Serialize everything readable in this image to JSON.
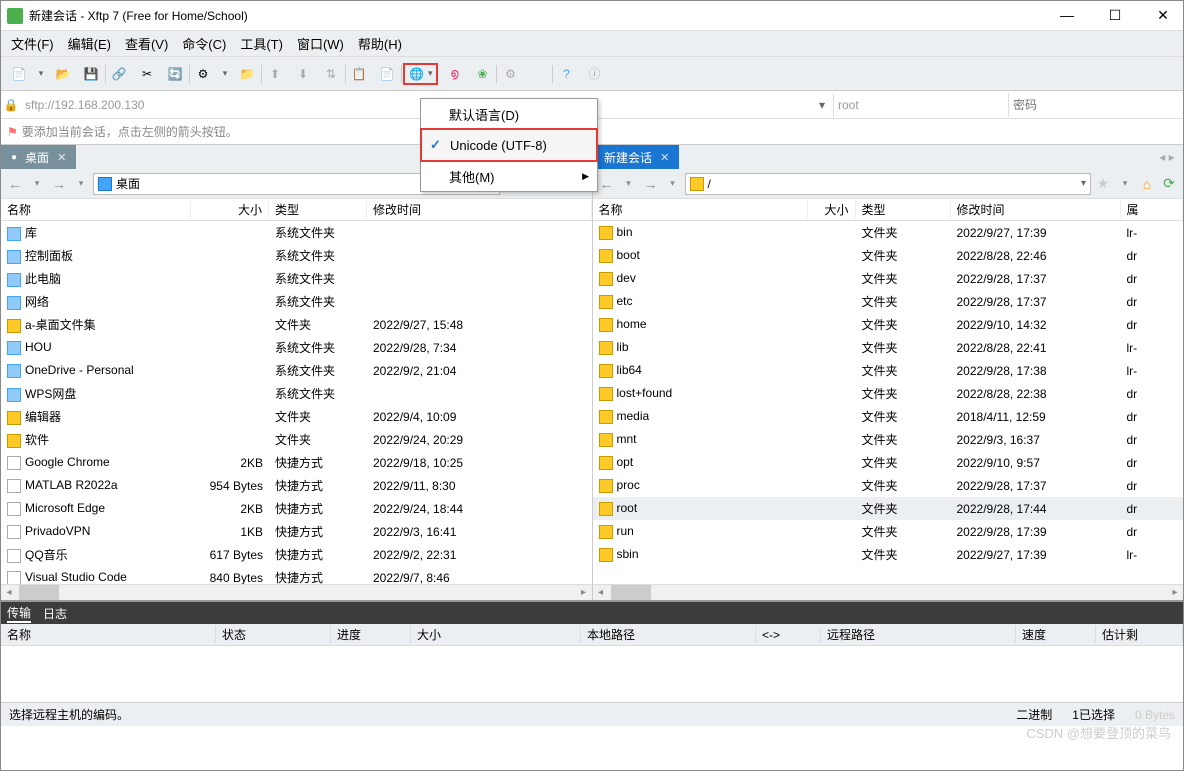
{
  "title": "新建会话 - Xftp 7 (Free for Home/School)",
  "menu": {
    "file": "文件(F)",
    "edit": "编辑(E)",
    "view": "查看(V)",
    "cmd": "命令(C)",
    "tool": "工具(T)",
    "win": "窗口(W)",
    "help": "帮助(H)"
  },
  "addr": {
    "url": "sftp://192.168.200.130",
    "user": "root",
    "pass_ph": "密码"
  },
  "hint": "要添加当前会话，点击左侧的箭头按钮。",
  "langmenu": {
    "default": "默认语言(D)",
    "utf8": "Unicode (UTF-8)",
    "other": "其他(M)"
  },
  "tabs": {
    "local": "桌面",
    "remote": "新建会话"
  },
  "local_path": "桌面",
  "remote_path": "/",
  "cols": {
    "name": "名称",
    "size": "大小",
    "type": "类型",
    "mtime": "修改时间",
    "attr": "属"
  },
  "remote_size_hdr": "大小",
  "local_files": [
    {
      "n": "库",
      "s": "",
      "t": "系统文件夹",
      "m": "",
      "i": "sys"
    },
    {
      "n": "控制面板",
      "s": "",
      "t": "系统文件夹",
      "m": "",
      "i": "sys"
    },
    {
      "n": "此电脑",
      "s": "",
      "t": "系统文件夹",
      "m": "",
      "i": "sys"
    },
    {
      "n": "网络",
      "s": "",
      "t": "系统文件夹",
      "m": "",
      "i": "sys"
    },
    {
      "n": "a-桌面文件集",
      "s": "",
      "t": "文件夹",
      "m": "2022/9/27, 15:48",
      "i": "f"
    },
    {
      "n": "HOU",
      "s": "",
      "t": "系统文件夹",
      "m": "2022/9/28, 7:34",
      "i": "sys"
    },
    {
      "n": "OneDrive - Personal",
      "s": "",
      "t": "系统文件夹",
      "m": "2022/9/2, 21:04",
      "i": "sys"
    },
    {
      "n": "WPS网盘",
      "s": "",
      "t": "系统文件夹",
      "m": "",
      "i": "sys"
    },
    {
      "n": "编辑器",
      "s": "",
      "t": "文件夹",
      "m": "2022/9/4, 10:09",
      "i": "f"
    },
    {
      "n": "软件",
      "s": "",
      "t": "文件夹",
      "m": "2022/9/24, 20:29",
      "i": "f"
    },
    {
      "n": "Google Chrome",
      "s": "2KB",
      "t": "快捷方式",
      "m": "2022/9/18, 10:25",
      "i": "link"
    },
    {
      "n": "MATLAB R2022a",
      "s": "954 Bytes",
      "t": "快捷方式",
      "m": "2022/9/11, 8:30",
      "i": "link"
    },
    {
      "n": "Microsoft Edge",
      "s": "2KB",
      "t": "快捷方式",
      "m": "2022/9/24, 18:44",
      "i": "link"
    },
    {
      "n": "PrivadoVPN",
      "s": "1KB",
      "t": "快捷方式",
      "m": "2022/9/3, 16:41",
      "i": "link"
    },
    {
      "n": "QQ音乐",
      "s": "617 Bytes",
      "t": "快捷方式",
      "m": "2022/9/2, 22:31",
      "i": "link"
    },
    {
      "n": "Visual Studio Code",
      "s": "840 Bytes",
      "t": "快捷方式",
      "m": "2022/9/7, 8:46",
      "i": "link"
    }
  ],
  "remote_files": [
    {
      "n": "bin",
      "t": "文件夹",
      "m": "2022/9/27, 17:39",
      "a": "lr-"
    },
    {
      "n": "boot",
      "t": "文件夹",
      "m": "2022/8/28, 22:46",
      "a": "dr"
    },
    {
      "n": "dev",
      "t": "文件夹",
      "m": "2022/9/28, 17:37",
      "a": "dr"
    },
    {
      "n": "etc",
      "t": "文件夹",
      "m": "2022/9/28, 17:37",
      "a": "dr"
    },
    {
      "n": "home",
      "t": "文件夹",
      "m": "2022/9/10, 14:32",
      "a": "dr"
    },
    {
      "n": "lib",
      "t": "文件夹",
      "m": "2022/8/28, 22:41",
      "a": "lr-"
    },
    {
      "n": "lib64",
      "t": "文件夹",
      "m": "2022/9/28, 17:38",
      "a": "lr-"
    },
    {
      "n": "lost+found",
      "t": "文件夹",
      "m": "2022/8/28, 22:38",
      "a": "dr"
    },
    {
      "n": "media",
      "t": "文件夹",
      "m": "2018/4/11, 12:59",
      "a": "dr"
    },
    {
      "n": "mnt",
      "t": "文件夹",
      "m": "2022/9/3, 16:37",
      "a": "dr"
    },
    {
      "n": "opt",
      "t": "文件夹",
      "m": "2022/9/10, 9:57",
      "a": "dr"
    },
    {
      "n": "proc",
      "t": "文件夹",
      "m": "2022/9/28, 17:37",
      "a": "dr"
    },
    {
      "n": "root",
      "t": "文件夹",
      "m": "2022/9/28, 17:44",
      "a": "dr",
      "sel": true
    },
    {
      "n": "run",
      "t": "文件夹",
      "m": "2022/9/28, 17:39",
      "a": "dr"
    },
    {
      "n": "sbin",
      "t": "文件夹",
      "m": "2022/9/27, 17:39",
      "a": "lr-"
    }
  ],
  "logtabs": {
    "transfer": "传输",
    "log": "日志"
  },
  "logcols": {
    "name": "名称",
    "status": "状态",
    "progress": "进度",
    "size": "大小",
    "localpath": "本地路径",
    "arrow": "<->",
    "remotepath": "远程路径",
    "speed": "速度",
    "eta": "估计剩"
  },
  "status": {
    "hint": "选择远程主机的编码。",
    "binary": "二进制",
    "sel": "1已选择",
    "bytes": "0 Bytes"
  },
  "watermark": "CSDN @想要登顶的菜鸟"
}
